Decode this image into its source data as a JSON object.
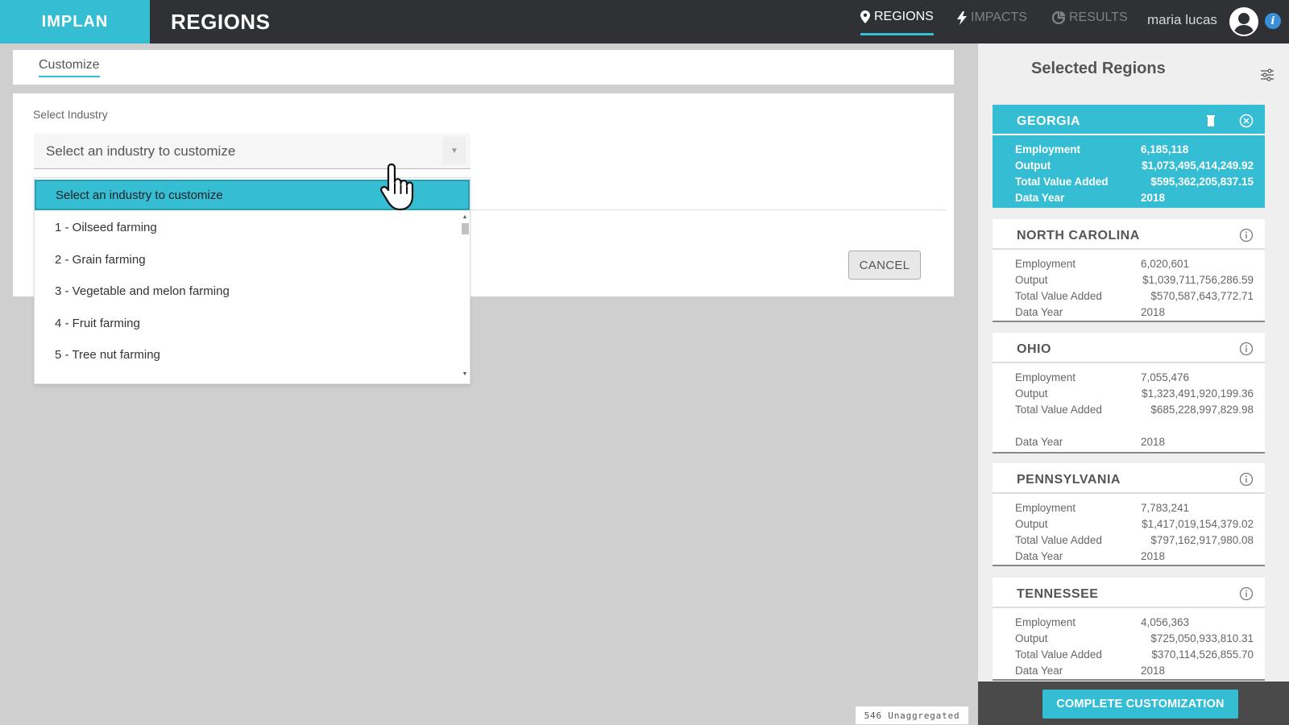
{
  "header": {
    "logo": "IMPLAN",
    "title": "REGIONS",
    "nav": [
      {
        "label": "REGIONS",
        "icon": "map-pin-icon",
        "active": true
      },
      {
        "label": "IMPACTS",
        "icon": "lightning-icon",
        "active": false
      },
      {
        "label": "RESULTS",
        "icon": "pie-chart-icon",
        "active": false
      }
    ],
    "user_name": "maria lucas",
    "info_glyph": "i"
  },
  "tabs": [
    {
      "label": "Customize"
    }
  ],
  "form": {
    "field_label": "Select Industry",
    "select_value": "Select an industry to customize",
    "cancel_label": "CANCEL"
  },
  "dropdown": {
    "selected": "Select an industry to customize",
    "options": [
      "1 - Oilseed farming",
      "2 - Grain farming",
      "3 - Vegetable and melon farming",
      "4 - Fruit farming",
      "5 - Tree nut farming"
    ]
  },
  "sidebar": {
    "title": "Selected Regions",
    "regions": [
      {
        "name": "GEORGIA",
        "active": true,
        "rows": [
          {
            "k": "Employment",
            "v": "6,185,118"
          },
          {
            "k": "Output",
            "v": "$1,073,495,414,249.92"
          },
          {
            "k": "Total Value Added",
            "v": "$595,362,205,837.15"
          },
          {
            "k": "Data Year",
            "v": "2018"
          }
        ]
      },
      {
        "name": "NORTH CAROLINA",
        "active": false,
        "rows": [
          {
            "k": "Employment",
            "v": "6,020,601"
          },
          {
            "k": "Output",
            "v": "$1,039,711,756,286.59"
          },
          {
            "k": "Total Value Added",
            "v": "$570,587,643,772.71"
          },
          {
            "k": "Data Year",
            "v": "2018"
          }
        ]
      },
      {
        "name": "OHIO",
        "active": false,
        "rows": [
          {
            "k": "Employment",
            "v": "7,055,476"
          },
          {
            "k": "Output",
            "v": "$1,323,491,920,199.36"
          },
          {
            "k": "Total Value Added",
            "v": "$685,228,997,829.98"
          },
          {
            "k": "Data Year",
            "v": "2018"
          }
        ]
      },
      {
        "name": "PENNSYLVANIA",
        "active": false,
        "rows": [
          {
            "k": "Employment",
            "v": "7,783,241"
          },
          {
            "k": "Output",
            "v": "$1,417,019,154,379.02"
          },
          {
            "k": "Total Value Added",
            "v": "$797,162,917,980.08"
          },
          {
            "k": "Data Year",
            "v": "2018"
          }
        ]
      },
      {
        "name": "TENNESSEE",
        "active": false,
        "rows": [
          {
            "k": "Employment",
            "v": "4,056,363"
          },
          {
            "k": "Output",
            "v": "$725,050,933,810.31"
          },
          {
            "k": "Total Value Added",
            "v": "$370,114,526,855.70"
          },
          {
            "k": "Data Year",
            "v": "2018"
          }
        ]
      }
    ],
    "complete_label": "COMPLETE CUSTOMIZATION"
  },
  "status": {
    "unaggregated": "546 Unaggregated"
  },
  "colors": {
    "accent": "#35bdd3",
    "topbar": "#2f3135",
    "background": "#cfcfcf"
  }
}
